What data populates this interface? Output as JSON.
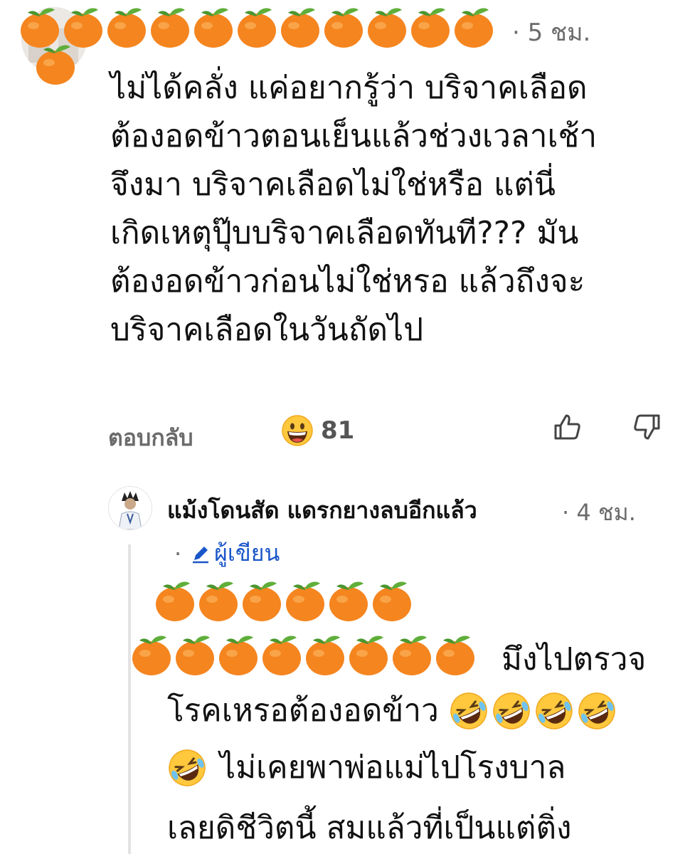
{
  "comment1": {
    "time": "· 5 ชม.",
    "text_lines": [
      "ไม่ได้คลั่ง แค่อยากรู้ว่า บริจาคเลือด",
      "ต้องอดข้าวตอนเย็นแล้วช่วงเวลาเช้า",
      "จึงมา บริจาคเลือดไม่ใช่หรือ แต่นี่",
      "เกิดเหตุปุ๊บบริจาคเลือดทันที??? มัน",
      "ต้องอดข้าวก่อนไม่ใช่หรอ แล้วถึงจะ",
      "บริจาคเลือดในวันถัดไป"
    ],
    "reply_label": "ตอบกลับ",
    "reaction_count": "81",
    "reaction_icon": "grinning-face-icon",
    "redaction_icon": "tangerine-emoji"
  },
  "comment2": {
    "author": "แม้งโดนสัด แดรกยางลบอีกแล้ว",
    "time": "· 4 ชม.",
    "author_tag_prefix": "·",
    "author_tag": "ผู้เขียน",
    "text_line1": "มึงไปตรวจ",
    "text_line2": "โรคเหรอต้องอดข้าว",
    "text_line3": "ไม่เคยพาพ่อแม่ไปโรงบาล",
    "text_line4": "เลยดิชีวิตนี้ สมแล้วที่เป็นแต่ติ่ง",
    "emoji_icon": "rolling-on-floor-laughing-icon"
  },
  "colors": {
    "muted": "#6b6b6b",
    "link": "#1a56c9",
    "thread_line": "#e3e3e3"
  }
}
